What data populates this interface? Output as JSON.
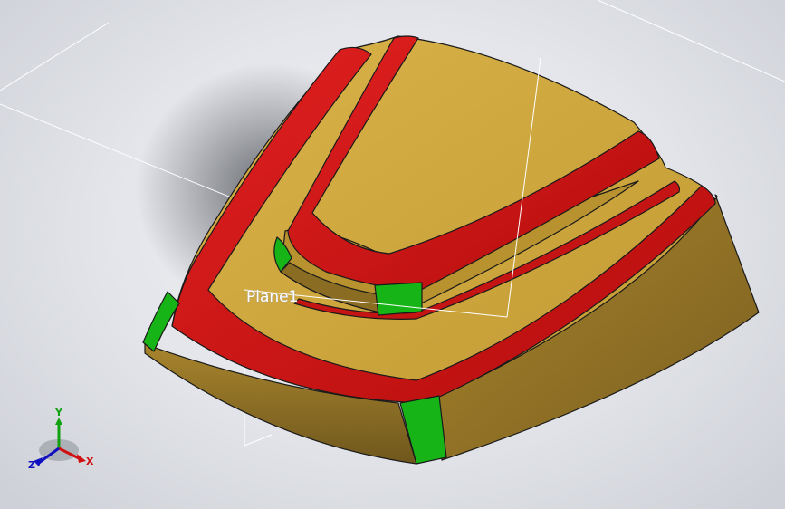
{
  "viewport": {
    "plane_label": "Plane1",
    "colors": {
      "face": "#c9a23c",
      "face_dark": "#7d6424",
      "fillet_red": "#d11414",
      "fillet_green": "#17b417",
      "edge": "#1a1a1a",
      "plane_line": "#ffffff"
    }
  },
  "triad": {
    "x_label": "X",
    "y_label": "Y",
    "z_label": "Z",
    "x_color": "#d01010",
    "y_color": "#10a010",
    "z_color": "#1010c0"
  }
}
